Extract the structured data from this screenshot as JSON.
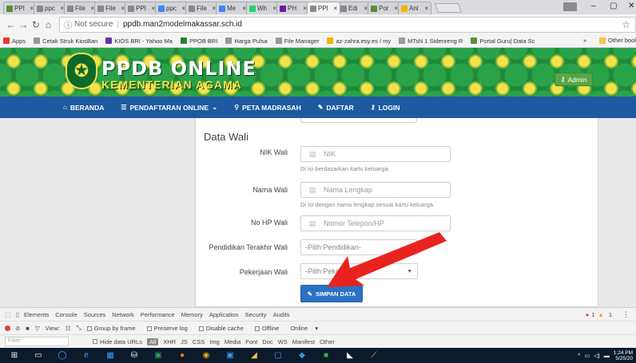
{
  "browser": {
    "tabs": [
      {
        "label": "PPI",
        "color": "#5b8c3a"
      },
      {
        "label": "ppc",
        "color": "#888888"
      },
      {
        "label": "File",
        "color": "#888888"
      },
      {
        "label": "File",
        "color": "#888888"
      },
      {
        "label": "PPI",
        "color": "#888888"
      },
      {
        "label": "ppc",
        "color": "#4285f4"
      },
      {
        "label": "File",
        "color": "#888888"
      },
      {
        "label": "Me",
        "color": "#4285f4"
      },
      {
        "label": "Wh",
        "color": "#25d366"
      },
      {
        "label": "PH",
        "color": "#6a1b9a"
      },
      {
        "label": "PPI",
        "color": "#888888"
      },
      {
        "label": "Edi",
        "color": "#888888"
      },
      {
        "label": "Por",
        "color": "#5b8c3a"
      },
      {
        "label": "Ani",
        "color": "#f4b400"
      }
    ],
    "active_tab_index": 10,
    "omnibox": {
      "security_label": "Not secure",
      "url": "ppdb.man2modelmakassar.sch.id"
    },
    "bookmarks": [
      {
        "label": "Apps",
        "color": "#e53935"
      },
      {
        "label": "Cetak Struk KiosBan",
        "color": "#999999"
      },
      {
        "label": "KIOS BRI - Yahoo Ma",
        "color": "#5e35b1"
      },
      {
        "label": "PPOB BRI",
        "color": "#2e7d32"
      },
      {
        "label": "Harga Pulsa",
        "color": "#999999"
      },
      {
        "label": "File Manager",
        "color": "#999999"
      },
      {
        "label": "az-zahra.esy.es / my",
        "color": "#f4b400"
      },
      {
        "label": "MTsN 1 Sidenreng R",
        "color": "#999999"
      },
      {
        "label": "Portal Guru| Data Sc",
        "color": "#5b8c3a"
      }
    ],
    "bookmarks_more": "»",
    "other_bookmarks": "Other bookmar"
  },
  "site": {
    "title": "PPDB ONLINE",
    "subtitle": "KEMENTERIAN AGAMA",
    "admin_label": "Admin",
    "nav": [
      {
        "label": "BERANDA",
        "icon": "home-icon",
        "glyph": "⌂"
      },
      {
        "label": "PENDAFTARAN ONLINE",
        "icon": "list-icon",
        "glyph": "☰",
        "caret": "⌄"
      },
      {
        "label": "PETA MADRASAH",
        "icon": "map-pin-icon",
        "glyph": "⚲"
      },
      {
        "label": "DAFTAR",
        "icon": "edit-icon",
        "glyph": "✎"
      },
      {
        "label": "LOGIN",
        "icon": "key-icon",
        "glyph": "⚷"
      }
    ]
  },
  "form": {
    "section_title": "Data Wali",
    "nik": {
      "label": "NIK Wali",
      "placeholder": "NIK",
      "help": "Di isi berdasarkan kartu keluarga."
    },
    "nama": {
      "label": "Nama Wali",
      "placeholder": "Nama Lengkap",
      "help": "Di isi dengan nama lengkap sesuai kartu keluarga."
    },
    "hp": {
      "label": "No HP Wali",
      "placeholder": "Nomor Telepon/HP"
    },
    "pendidikan": {
      "label": "Pendidikan Terakhir Wali",
      "selected": "-Pilih Pendidikan-"
    },
    "pekerjaan": {
      "label": "Pekerjaan Wali",
      "selected": "-Pilih Pekerjaan-"
    },
    "submit_label": "SIMPAN DATA"
  },
  "devtools": {
    "tabs": [
      "Elements",
      "Console",
      "Sources",
      "Network",
      "Performance",
      "Memory",
      "Application",
      "Security",
      "Audits"
    ],
    "error_count": "1",
    "warning_count": "1",
    "toolbar": {
      "view_label": "View:",
      "group_by_frame": "Group by frame",
      "preserve_log": "Preserve log",
      "disable_cache": "Disable cache",
      "offline": "Offline",
      "online": "Online"
    },
    "filter_placeholder": "Filter",
    "filter_types": [
      "Hide data URLs",
      "All",
      "XHR",
      "JS",
      "CSS",
      "Img",
      "Media",
      "Font",
      "Doc",
      "WS",
      "Manifest",
      "Other"
    ]
  },
  "taskbar": {
    "time": "1:24 PM",
    "date": "5/25/20"
  }
}
